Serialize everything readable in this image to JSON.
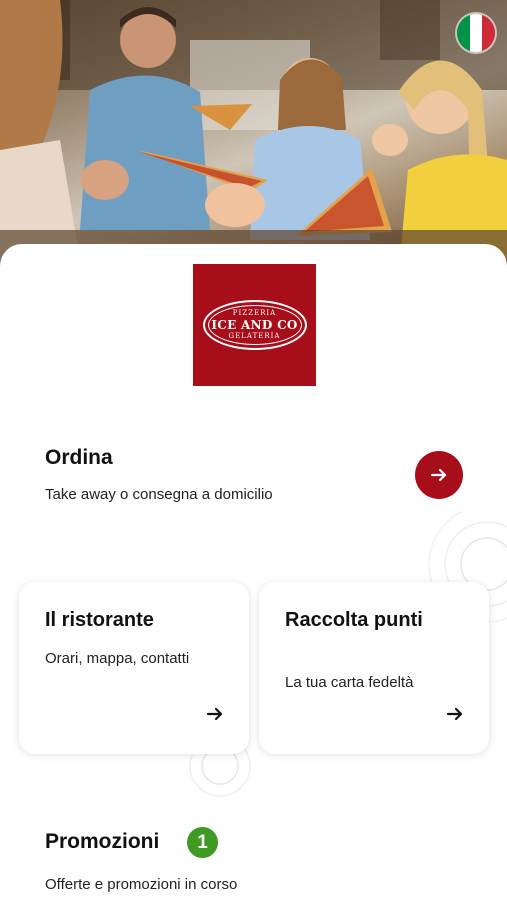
{
  "hero": {
    "language": "Italiano",
    "flag_colors": [
      "#009246",
      "#ffffff",
      "#ce2b37"
    ]
  },
  "logo": {
    "top": "PIZZERIA",
    "main": "ICE AND CO",
    "bottom": "GELATERIA",
    "background": "#a80d1a"
  },
  "order": {
    "title": "Ordina",
    "subtitle": "Take away o consegna a domicilio",
    "icon": "arrow-right-icon"
  },
  "cards": [
    {
      "title": "Il ristorante",
      "subtitle": "Orari, mappa, contatti",
      "icon": "arrow-right-icon"
    },
    {
      "title": "Raccolta punti",
      "subtitle": "La tua carta fedeltà",
      "icon": "arrow-right-icon"
    }
  ],
  "promo": {
    "title": "Promozioni",
    "badge": "1",
    "subtitle": "Offerte e promozioni in corso",
    "badge_color": "#3f9a22"
  },
  "colors": {
    "accent": "#a80d1a"
  }
}
